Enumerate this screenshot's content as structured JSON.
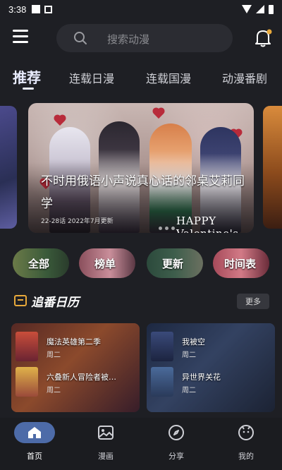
{
  "status_bar": {
    "time": "3:38"
  },
  "search": {
    "placeholder": "搜索动漫"
  },
  "tabs": [
    {
      "label": "推荐"
    },
    {
      "label": "连载日漫"
    },
    {
      "label": "连载国漫"
    },
    {
      "label": "动漫番剧"
    }
  ],
  "banner": {
    "title": "不时用俄语小声说真心话的邻桌艾莉同学",
    "subtitle": "22-28话 2022年7月更新",
    "decor_text": "HAPPY Valentine's Day"
  },
  "categories": [
    {
      "label": "全部"
    },
    {
      "label": "榜单"
    },
    {
      "label": "更新"
    },
    {
      "label": "时间表"
    }
  ],
  "section": {
    "title": "追番日历",
    "more_label": "更多"
  },
  "calendar_cards": [
    {
      "items": [
        {
          "name": "魔法英雄第二季",
          "ep": "周二"
        },
        {
          "name": "六叠新人冒险者被…",
          "ep": "周二"
        }
      ]
    },
    {
      "items": [
        {
          "name": "我被空",
          "ep": "周二"
        },
        {
          "name": "异世界关花",
          "ep": "周二"
        }
      ]
    }
  ],
  "bottom_nav": [
    {
      "label": "首页",
      "icon": "home-icon",
      "active": true
    },
    {
      "label": "漫画",
      "icon": "image-icon",
      "active": false
    },
    {
      "label": "分享",
      "icon": "compass-icon",
      "active": false
    },
    {
      "label": "我的",
      "icon": "profile-icon",
      "active": false
    }
  ],
  "colors": {
    "background": "#1e1f24",
    "accent": "#4d6ba8",
    "tab_active": "#e9ecff",
    "section_icon": "#e8a93b"
  }
}
